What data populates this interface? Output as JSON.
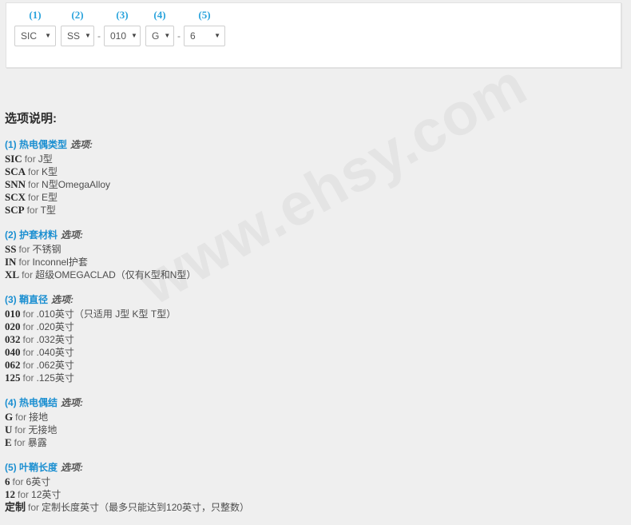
{
  "watermark": {
    "text": "www.ehsy.com"
  },
  "configurator": {
    "selectors": [
      {
        "number": "(1)",
        "value": "SIC",
        "caret": "chevron-down-icon",
        "separator_after": ""
      },
      {
        "number": "(2)",
        "value": "SS",
        "caret": "chevron-down-icon",
        "separator_after": "-"
      },
      {
        "number": "(3)",
        "value": "010",
        "caret": "chevron-down-icon",
        "separator_after": ""
      },
      {
        "number": "(4)",
        "value": "G",
        "caret": "chevron-down-icon",
        "separator_after": "-"
      },
      {
        "number": "(5)",
        "value": "6",
        "caret": "chevron-down-icon",
        "separator_after": ""
      }
    ],
    "caret_glyph": "▼"
  },
  "options": {
    "title": "选项说明:",
    "suffix_label": "选项:",
    "for_word": "for",
    "groups": [
      {
        "head": "(1) 热电偶类型",
        "items": [
          {
            "code": "SIC",
            "desc": "J型"
          },
          {
            "code": "SCA",
            "desc": "K型"
          },
          {
            "code": "SNN",
            "desc": "N型OmegaAlloy"
          },
          {
            "code": "SCX",
            "desc": "E型"
          },
          {
            "code": "SCP",
            "desc": "T型"
          }
        ]
      },
      {
        "head": "(2) 护套材料",
        "items": [
          {
            "code": "SS",
            "desc": "不锈钢"
          },
          {
            "code": "IN",
            "desc": "Inconnel护套"
          },
          {
            "code": "XL",
            "desc": "超级OMEGACLAD（仅有K型和N型）"
          }
        ]
      },
      {
        "head": "(3) 鞘直径",
        "items": [
          {
            "code": "010",
            "desc": ".010英寸（只适用 J型 K型 T型）"
          },
          {
            "code": "020",
            "desc": ".020英寸"
          },
          {
            "code": "032",
            "desc": ".032英寸"
          },
          {
            "code": "040",
            "desc": ".040英寸"
          },
          {
            "code": "062",
            "desc": ".062英寸"
          },
          {
            "code": "125",
            "desc": ".125英寸"
          }
        ]
      },
      {
        "head": "(4) 热电偶结",
        "items": [
          {
            "code": "G",
            "desc": "接地"
          },
          {
            "code": "U",
            "desc": "无接地"
          },
          {
            "code": "E",
            "desc": "暴露"
          }
        ]
      },
      {
        "head": "(5) 叶鞘长度",
        "items": [
          {
            "code": "6",
            "desc": "6英寸"
          },
          {
            "code": "12",
            "desc": "12英寸"
          },
          {
            "code": "定制",
            "desc": "定制长度英寸（最多只能达到120英寸，只整数）"
          }
        ]
      }
    ]
  },
  "colors": {
    "accent_blue": "#29a3dc",
    "heading_blue": "#1b8fd1",
    "page_bg": "#efefef",
    "panel_bg": "#ffffff"
  }
}
